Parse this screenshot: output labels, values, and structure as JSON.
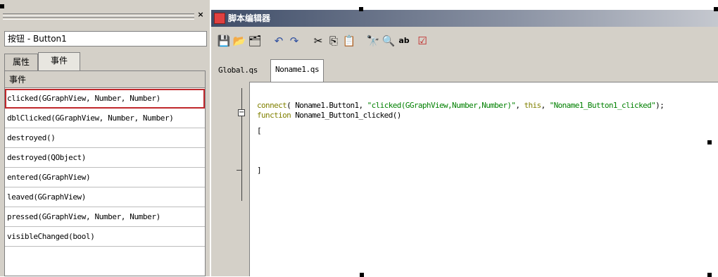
{
  "left_panel": {
    "close_glyph": "×",
    "object_title": "按钮 - Button1",
    "tabs": [
      {
        "label": "属性"
      },
      {
        "label": "事件"
      }
    ],
    "events_header": "事件",
    "events": [
      {
        "label": "clicked(GGraphView, Number, Number)",
        "selected": true
      },
      {
        "label": "dblClicked(GGraphView, Number, Number)"
      },
      {
        "label": "destroyed()"
      },
      {
        "label": "destroyed(QObject)"
      },
      {
        "label": "entered(GGraphView)"
      },
      {
        "label": "leaved(GGraphView)"
      },
      {
        "label": "pressed(GGraphView, Number, Number)"
      },
      {
        "label": "visibleChanged(bool)"
      }
    ]
  },
  "editor": {
    "title": "脚本编辑器",
    "toolbar_icons": [
      {
        "name": "save-icon",
        "glyph": "💾"
      },
      {
        "name": "open-icon",
        "glyph": "📂"
      },
      {
        "name": "save-all-icon",
        "glyph": "🗂"
      },
      {
        "name": "undo-icon",
        "glyph": "↶"
      },
      {
        "name": "redo-icon",
        "glyph": "↷"
      },
      {
        "name": "cut-icon",
        "glyph": "✂"
      },
      {
        "name": "copy-icon",
        "glyph": "⎘"
      },
      {
        "name": "paste-icon",
        "glyph": "📋"
      },
      {
        "name": "find-icon",
        "glyph": "🔭"
      },
      {
        "name": "find-next-icon",
        "glyph": "🔍"
      },
      {
        "name": "replace-icon",
        "glyph": "ab"
      },
      {
        "name": "check-icon",
        "glyph": "☑"
      }
    ],
    "file_tabs": [
      {
        "label": "Global.qs"
      },
      {
        "label": "Noname1.qs"
      }
    ],
    "code": {
      "line1_kw": "connect",
      "line1_rest": "( Noname1.Button1, ",
      "line1_str1": "\"clicked(GGraphView,Number,Number)\"",
      "line1_mid": ", ",
      "line1_this": "this",
      "line1_sep": ", ",
      "line1_str2": "\"Noname1_Button1_clicked\"",
      "line1_end": ");",
      "line2_kw": "function",
      "line2_rest": " Noname1_Button1_clicked()",
      "line3": "[",
      "line4": "]"
    },
    "colors": {
      "keyword": "#808000",
      "string": "#008000",
      "selection": "#c0282c"
    }
  }
}
